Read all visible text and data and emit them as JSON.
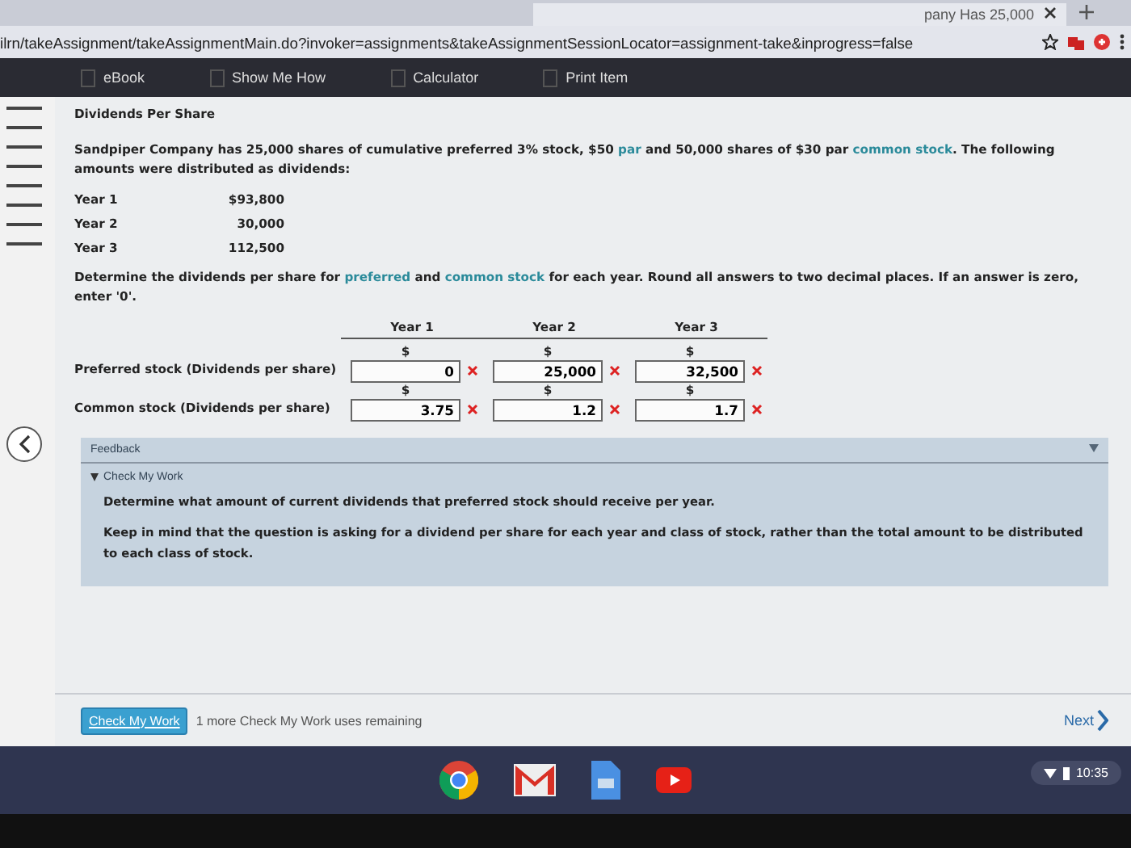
{
  "browser": {
    "tab_title": "pany Has 25,000",
    "address": "ilrn/takeAssignment/takeAssignmentMain.do?invoker=assignments&takeAssignmentSessionLocator=assignment-take&inprogress=false"
  },
  "toolbar": [
    "eBook",
    "Show Me How",
    "Calculator",
    "Print Item"
  ],
  "question": {
    "title": "Dividends Per Share",
    "intro": [
      {
        "text": "Sandpiper Company has 25,000 shares of cumulative preferred 3% stock, $50 ",
        "link": false
      },
      {
        "text": "par",
        "link": true
      },
      {
        "text": " and 50,000 shares of $30 par ",
        "link": false
      },
      {
        "text": "common stock",
        "link": true
      },
      {
        "text": ". The following amounts were distributed as dividends:",
        "link": false
      }
    ],
    "amounts": [
      {
        "year": "Year 1",
        "amount": "$93,800"
      },
      {
        "year": "Year 2",
        "amount": "30,000"
      },
      {
        "year": "Year 3",
        "amount": "112,500"
      }
    ],
    "instruction": [
      {
        "text": "Determine the dividends per share for ",
        "link": false
      },
      {
        "text": "preferred",
        "link": true
      },
      {
        "text": " and ",
        "link": false
      },
      {
        "text": "common stock",
        "link": true
      },
      {
        "text": " for each year. Round all answers to two decimal places. If an answer is zero, enter '0'.",
        "link": false
      }
    ],
    "columns": [
      "Year 1",
      "Year 2",
      "Year 3"
    ],
    "rows": [
      {
        "label": "Preferred stock (Dividends per share)",
        "cells": [
          {
            "currency": "$",
            "value": "0",
            "correct": false
          },
          {
            "currency": "$",
            "value": "25,000",
            "correct": false
          },
          {
            "currency": "$",
            "value": "32,500",
            "correct": false
          }
        ]
      },
      {
        "label": "Common stock (Dividends per share)",
        "cells": [
          {
            "currency": "$",
            "value": "3.75",
            "correct": false
          },
          {
            "currency": "$",
            "value": "1.2",
            "correct": false
          },
          {
            "currency": "$",
            "value": "1.7",
            "correct": false
          }
        ]
      }
    ]
  },
  "feedback": {
    "title": "Feedback",
    "check_title": "Check My Work",
    "expanded": true,
    "paragraphs": [
      "Determine what amount of current dividends that preferred stock should receive per year.",
      "Keep in mind that the question is asking for a dividend per share for each year and class of stock, rather than the total amount to be distributed to each class of stock."
    ]
  },
  "footer": {
    "button": "Check My Work",
    "remaining": "1 more Check My Work uses remaining",
    "next": "Next"
  },
  "shelf": {
    "time": "10:35"
  }
}
